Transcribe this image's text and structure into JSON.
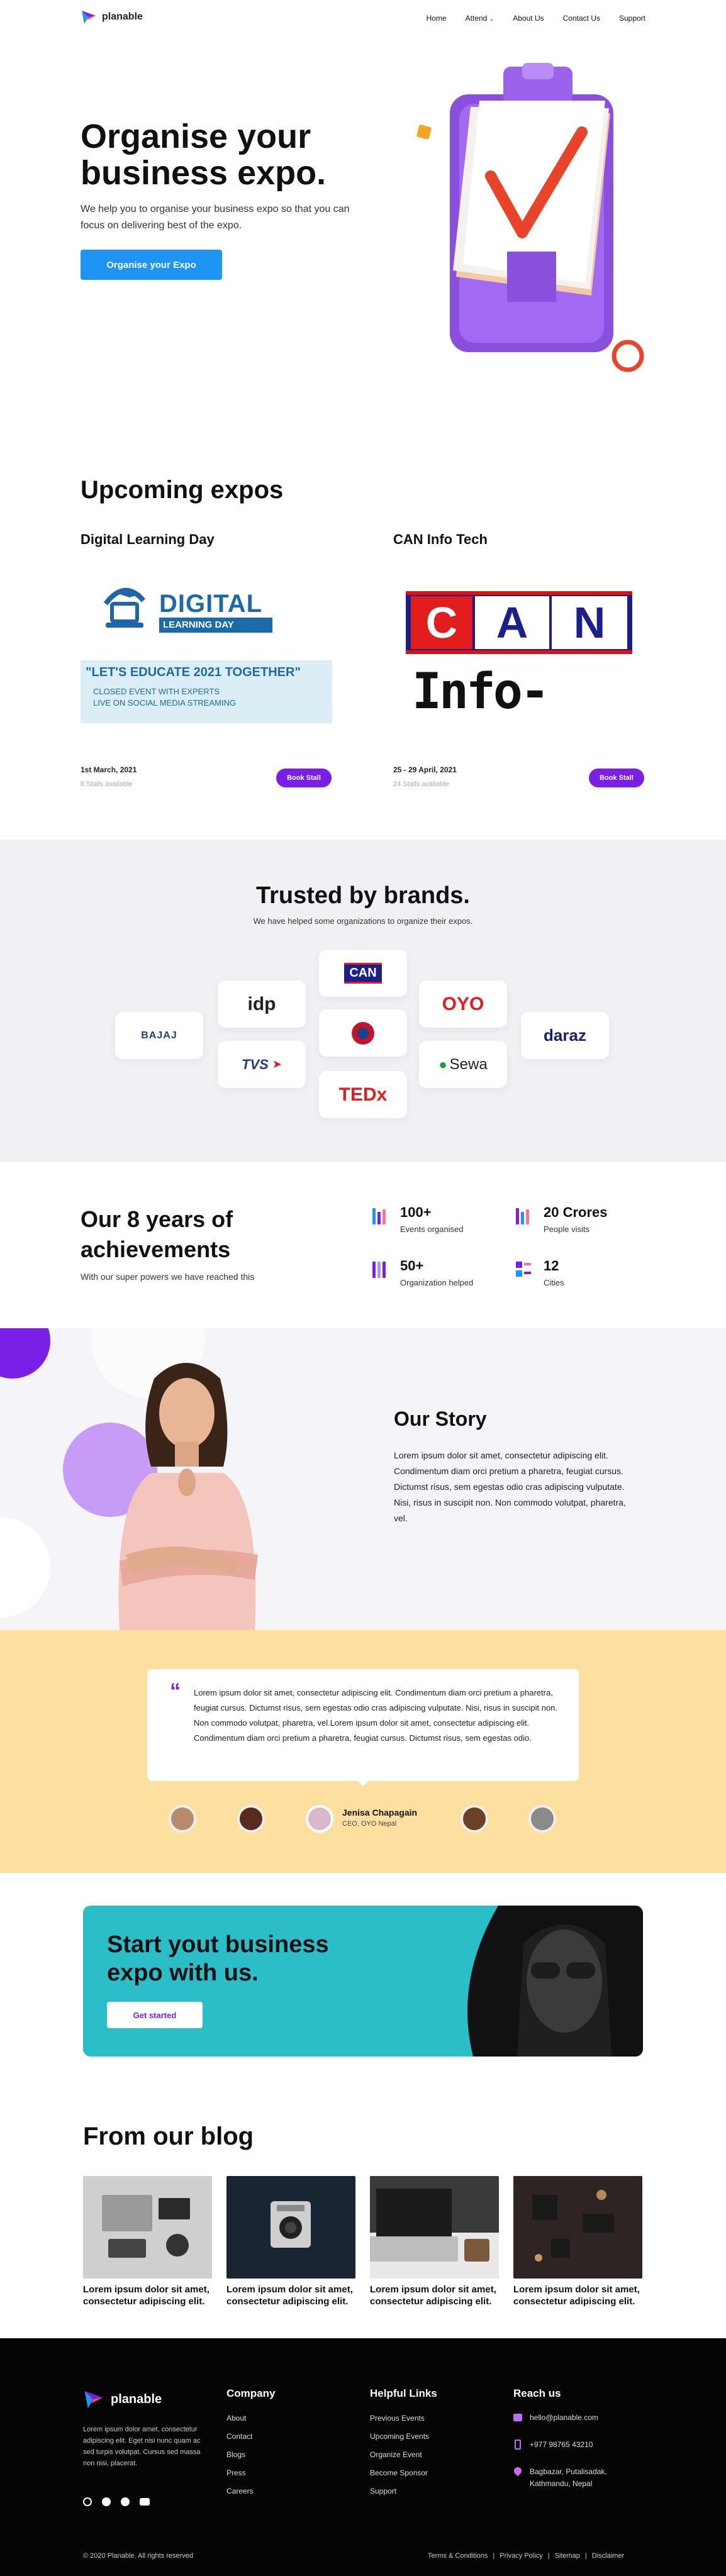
{
  "nav": {
    "logo": "planable",
    "links": [
      "Home",
      "Attend",
      "About Us",
      "Contact Us",
      "Support"
    ]
  },
  "hero": {
    "title": "Organise your business expo.",
    "subtitle": "We help you to organise your business expo so that you can focus on delivering best of the expo.",
    "cta": "Organise your Expo"
  },
  "expos": {
    "heading": "Upcoming expos",
    "items": [
      {
        "title": "Digital Learning Day",
        "banner_line1": "DIGITAL",
        "banner_line2": "LEARNING DAY",
        "banner_quote": "\"LET'S EDUCATE 2021 TOGETHER\"",
        "banner_sub1": "CLOSED EVENT WITH EXPERTS",
        "banner_sub2": "LIVE ON SOCIAL MEDIA STREAMING",
        "date": "1st March, 2021",
        "stalls": "8 Stalls available",
        "button": "Book Stall"
      },
      {
        "title": "CAN Info Tech",
        "banner_can": "CAN",
        "banner_info": "Info-Tech",
        "date": "25 - 29 April, 2021",
        "stalls": "24 Stalls available",
        "button": "Book Stall"
      }
    ]
  },
  "brands": {
    "heading": "Trusted by brands.",
    "subtitle": "We have helped some organizations to organize their expos.",
    "logos": [
      "BAJAJ",
      "idp",
      "TVS",
      "CAN",
      "TEDx",
      "OYO",
      "Sewa",
      "daraz"
    ]
  },
  "achievements": {
    "heading": "Our 8 years of achievements",
    "subtitle": "With our super powers we have reached this",
    "stats": [
      {
        "value": "100+",
        "label": "Events organised"
      },
      {
        "value": "20 Crores",
        "label": "People visits"
      },
      {
        "value": "50+",
        "label": "Organization helped"
      },
      {
        "value": "12",
        "label": "Cities"
      }
    ]
  },
  "story": {
    "heading": "Our Story",
    "body": "Lorem ipsum dolor sit amet, consectetur adipiscing elit. Condimentum diam orci pretium a pharetra, feugiat cursus. Dictumst risus, sem egestas odio cras adipiscing vulputate. Nisi, risus in suscipit non. Non commodo volutpat, pharetra, vel."
  },
  "testimonial": {
    "quote": "Lorem ipsum dolor sit amet, consectetur adipiscing elit. Condimentum diam orci pretium a pharetra, feugiat cursus. Dictumst risus, sem egestas odio cras adipiscing vulputate. Nisi, risus in suscipit non. Non commodo volutpat, pharetra, vel.Lorem ipsum dolor sit amet, consectetur adipiscing elit. Condimentum diam orci pretium a pharetra, feugiat cursus. Dictumst risus, sem egestas odio.",
    "name": "Jenisa Chapagain",
    "role": "CEO, OYO Nepal"
  },
  "cta": {
    "heading": "Start yout business expo with us.",
    "button": "Get started"
  },
  "blog": {
    "heading": "From our blog",
    "posts": [
      {
        "title": "Lorem ipsum dolor sit amet, consectetur adipiscing elit."
      },
      {
        "title": "Lorem ipsum dolor sit amet, consectetur adipiscing elit."
      },
      {
        "title": "Lorem ipsum dolor sit amet, consectetur adipiscing elit."
      },
      {
        "title": "Lorem ipsum dolor sit amet, consectetur adipiscing elit."
      }
    ]
  },
  "footer": {
    "logo": "planable",
    "about": "Lorem ipsum dolor amet, consectetur adipiscing elit. Eget nisi nunc quam ac sed turpis volutpat. Cursus sed massa non nisi, placerat.",
    "company_heading": "Company",
    "company_links": [
      "About",
      "Contact",
      "Blogs",
      "Press",
      "Careers"
    ],
    "helpful_heading": "Helpful Links",
    "helpful_links": [
      "Previous Events",
      "Upcoming Events",
      "Organize Event",
      "Become Sponsor",
      "Support"
    ],
    "reach_heading": "Reach us",
    "email": "hello@planable.com",
    "phone": "+977 98765 43210",
    "address": "Bagbazar, Putalisadak, Kathmandu, Nepal",
    "copyright": "© 2020 Planable. All rights reserved",
    "legal_links": [
      "Terms & Conditions",
      "Privacy Policy",
      "Sitemap",
      "Disclaimer"
    ]
  },
  "colors": {
    "primary_blue": "#1e94f5",
    "purple": "#7a1fe6",
    "brands_bg": "#f1f1f5",
    "testimonial_bg": "#fddfa0",
    "cta_bg": "#2bbec9"
  }
}
